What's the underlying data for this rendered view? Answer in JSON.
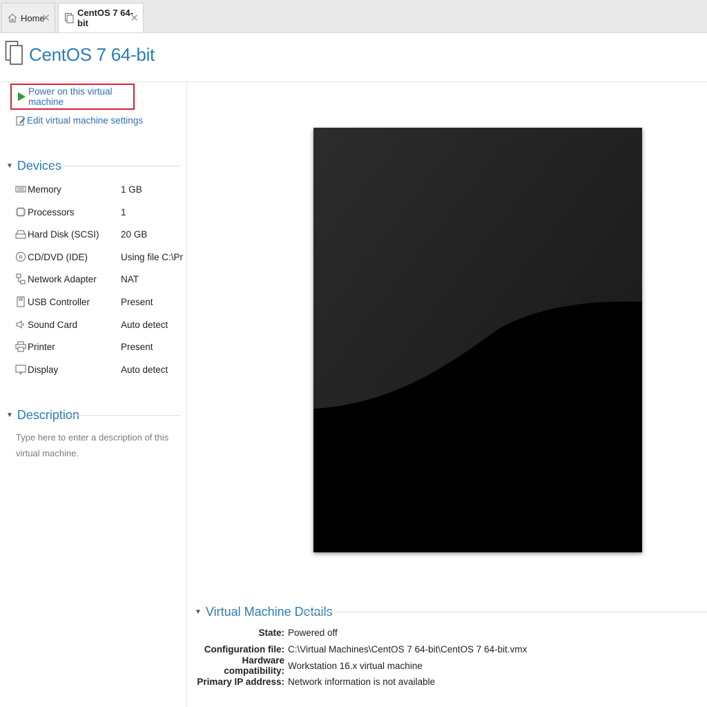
{
  "tabs": [
    {
      "label": "Home",
      "icon": "home-icon"
    },
    {
      "label": "CentOS 7 64-bit",
      "icon": "vm-icon",
      "active": true
    }
  ],
  "header": {
    "title": "CentOS 7 64-bit"
  },
  "actions": {
    "power_on": "Power on this virtual machine",
    "edit_settings": "Edit virtual machine settings"
  },
  "devices": {
    "title": "Devices",
    "items": [
      {
        "name": "Memory",
        "value": "1 GB",
        "icon": "memory-icon"
      },
      {
        "name": "Processors",
        "value": "1",
        "icon": "processor-icon"
      },
      {
        "name": "Hard Disk (SCSI)",
        "value": "20 GB",
        "icon": "hard-disk-icon"
      },
      {
        "name": "CD/DVD (IDE)",
        "value": "Using file C:\\Pro...",
        "icon": "cd-dvd-icon"
      },
      {
        "name": "Network Adapter",
        "value": "NAT",
        "icon": "network-adapter-icon"
      },
      {
        "name": "USB Controller",
        "value": "Present",
        "icon": "usb-icon"
      },
      {
        "name": "Sound Card",
        "value": "Auto detect",
        "icon": "sound-card-icon"
      },
      {
        "name": "Printer",
        "value": "Present",
        "icon": "printer-icon"
      },
      {
        "name": "Display",
        "value": "Auto detect",
        "icon": "display-icon"
      }
    ]
  },
  "description": {
    "title": "Description",
    "placeholder": "Type here to enter a description of this virtual machine."
  },
  "details": {
    "title": "Virtual Machine Details",
    "rows": [
      {
        "key": "State:",
        "value": "Powered off"
      },
      {
        "key": "Configuration file:",
        "value": "C:\\Virtual Machines\\CentOS 7 64-bit\\CentOS 7 64-bit.vmx"
      },
      {
        "key": "Hardware compatibility:",
        "value": "Workstation 16.x virtual machine"
      },
      {
        "key": "Primary IP address:",
        "value": "Network information is not available"
      }
    ]
  },
  "colors": {
    "accent": "#2b7bb9",
    "highlight": "#d9203a",
    "play": "#2f9e3a"
  }
}
